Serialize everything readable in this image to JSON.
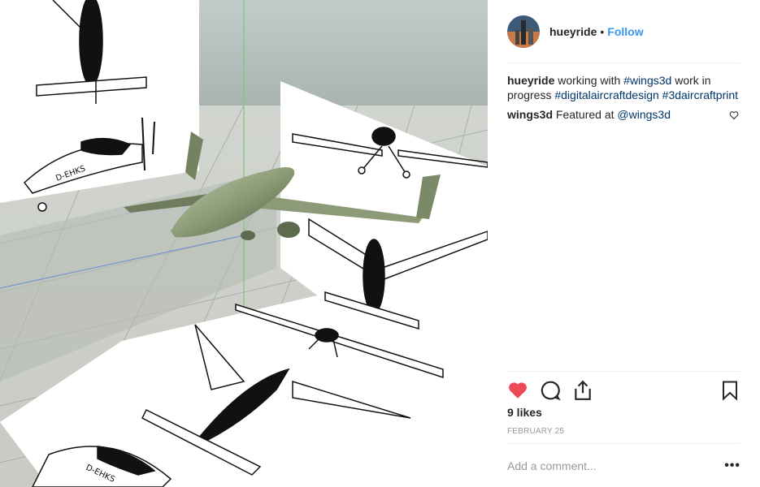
{
  "post": {
    "image_alt": "3D aircraft model over printed blueprint drawings"
  },
  "header": {
    "username": "hueyride",
    "separator": "•",
    "follow_label": "Follow"
  },
  "caption": {
    "username": "hueyride",
    "text_1": "working with",
    "tag_1": "#wings3d",
    "text_2": "work in progress",
    "tag_2": "#digitalaircraftdesign",
    "tag_3": "#3daircraftprint"
  },
  "comment": {
    "username": "wings3d",
    "text": "Featured at",
    "mention": "@wings3d"
  },
  "stats": {
    "likes": "9 likes",
    "date": "FEBRUARY 25"
  },
  "add_comment": {
    "placeholder": "Add a comment...",
    "more": "•••"
  },
  "colors": {
    "like_red": "#ed4956",
    "link_blue": "#3897f0",
    "tag_blue": "#003569"
  },
  "icons": {
    "like": "heart-filled-icon",
    "comment": "comment-bubble-icon",
    "share": "share-icon",
    "save": "bookmark-icon"
  }
}
